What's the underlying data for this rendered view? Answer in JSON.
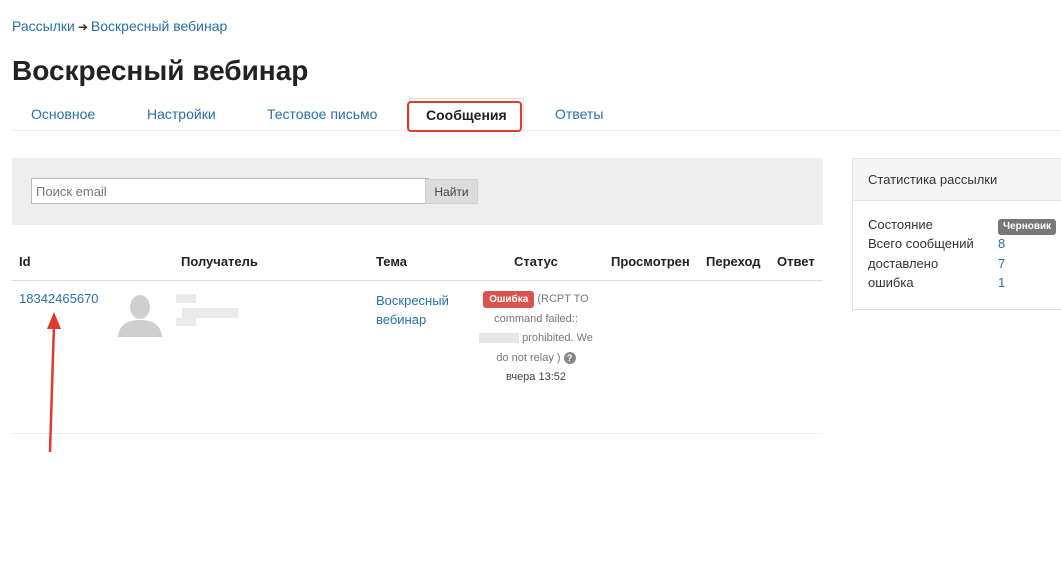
{
  "breadcrumb": {
    "parent": "Рассылки",
    "separator": "➜",
    "current": "Воскресный вебинар"
  },
  "page_title": "Воскресный вебинар",
  "tabs": [
    {
      "label": "Основное"
    },
    {
      "label": "Настройки"
    },
    {
      "label": "Тестовое письмо"
    },
    {
      "label": "Сообщения",
      "active": true
    },
    {
      "label": "Ответы"
    }
  ],
  "search": {
    "placeholder": "Поиск email",
    "button": "Найти"
  },
  "table": {
    "headers": [
      "Id",
      "Получатель",
      "Тема",
      "Статус",
      "Просмотрен",
      "Переход",
      "Ответ"
    ],
    "rows": [
      {
        "id": "18342465670",
        "subject": "Воскресный вебинар",
        "status_badge": "Ошибка",
        "status_text_1": "(RCPT TO command failed::",
        "status_text_2": "prohibited. We do not relay )",
        "help": "?",
        "time": "вчера 13:52"
      }
    ]
  },
  "stats": {
    "title": "Статистика рассылки",
    "rows": [
      {
        "label": "Состояние",
        "badge": "Черновик"
      },
      {
        "label": "Всего сообщений",
        "value": "8"
      },
      {
        "label": "доставлено",
        "value": "7"
      },
      {
        "label": "ошибка",
        "value": "1"
      }
    ]
  },
  "colors": {
    "link": "#2a6fa8",
    "error_badge": "#d9534f",
    "draft_badge": "#777777",
    "highlight": "#e03a2f",
    "arrow": "#e03a2f"
  }
}
